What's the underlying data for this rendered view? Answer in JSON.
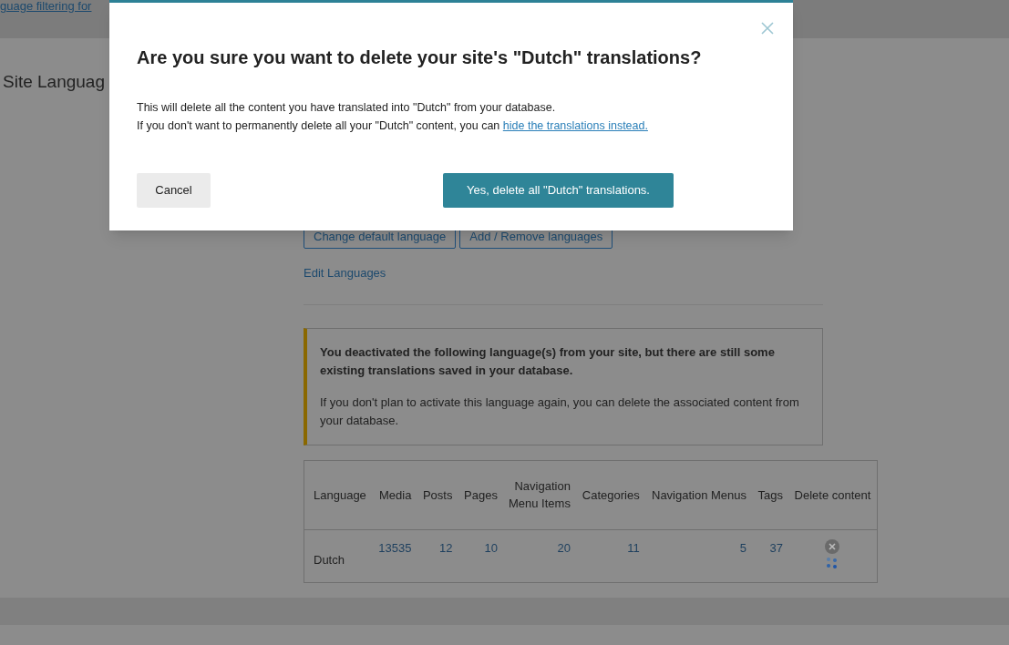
{
  "top_bar": {
    "link": "guage filtering for"
  },
  "page": {
    "heading": "Site Languag",
    "buttons": [
      "Change default language",
      "Add / Remove languages"
    ],
    "edit_link": "Edit Languages",
    "notice": {
      "title": "You deactivated the following language(s) from your site, but there are still some existing translations saved in your database.",
      "body": "If you don't plan to activate this language again, you can delete the associated content from your database."
    },
    "table": {
      "columns": [
        "Language",
        "Media",
        "Posts",
        "Pages",
        "Navigation Menu Items",
        "Categories",
        "Navigation Menus",
        "Tags",
        "Delete content"
      ],
      "rows": [
        {
          "cells": [
            "Dutch",
            "13535",
            "12",
            "10",
            "20",
            "11",
            "5",
            "37"
          ],
          "deleting": true
        }
      ]
    }
  },
  "dialog": {
    "title": "Are you sure you want to delete your site's \"Dutch\" translations?",
    "line_1": "This will delete all the content you have translated into \"Dutch\" from your database.",
    "line_2": "If you don't want to permanently delete all your \"Dutch\" content, you can",
    "link": "hide the translations instead.",
    "cancel": "Cancel",
    "confirm": "Yes, delete all \"Dutch\" translations."
  }
}
